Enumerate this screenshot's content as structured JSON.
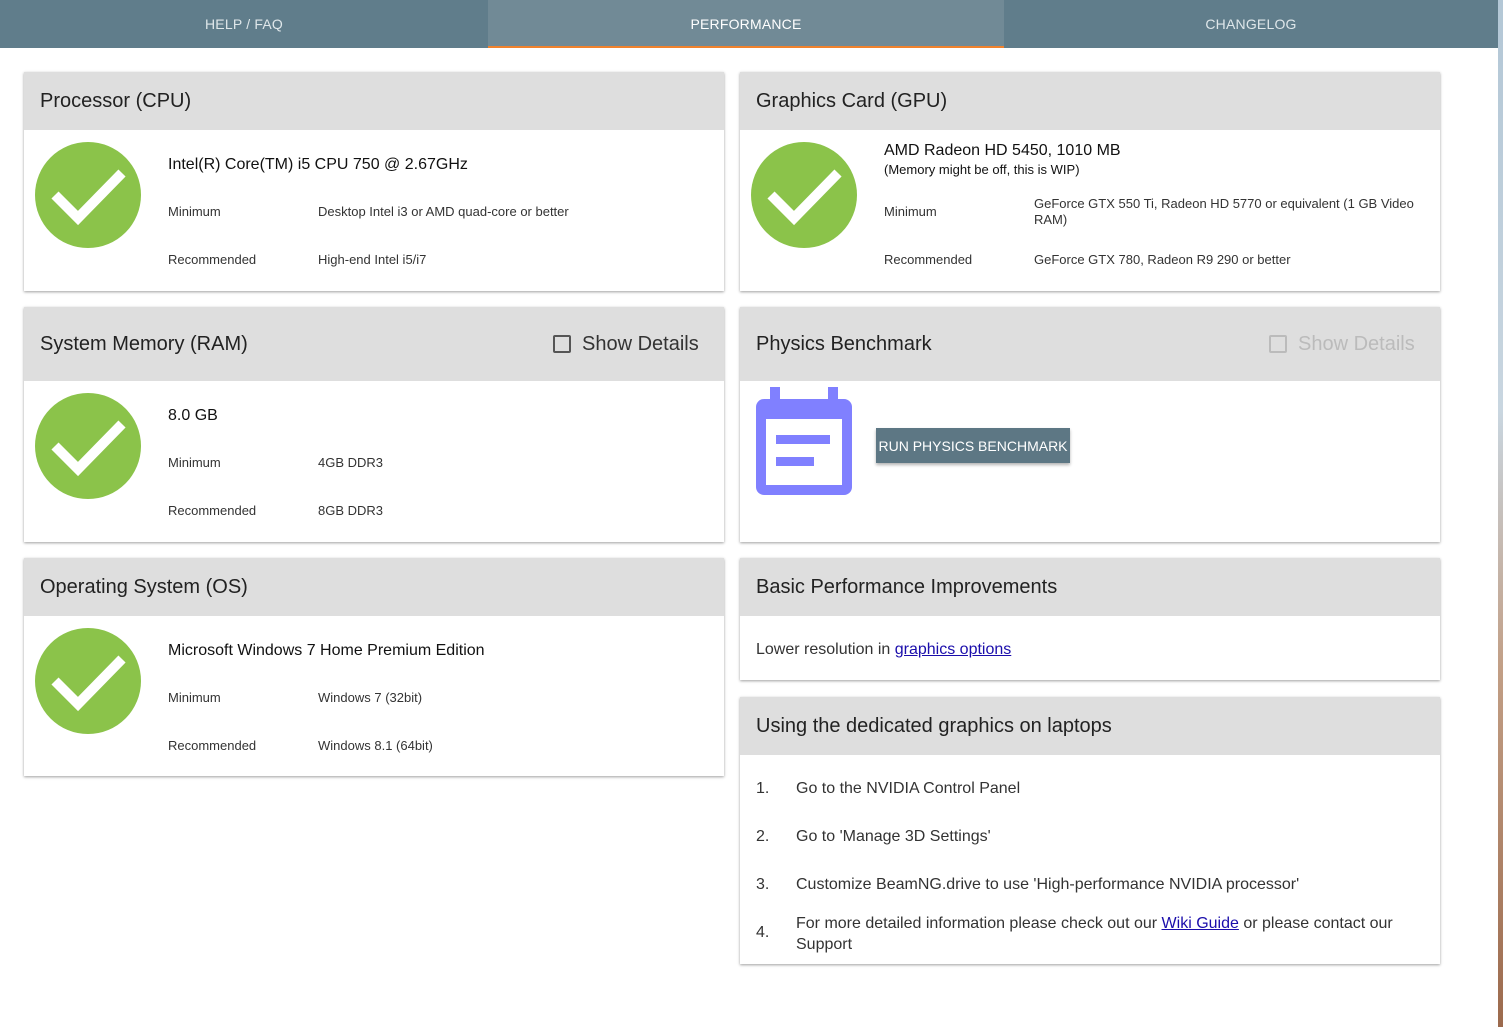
{
  "tabs": [
    {
      "label": "HELP / FAQ"
    },
    {
      "label": "PERFORMANCE"
    },
    {
      "label": "CHANGELOG"
    }
  ],
  "active_tab": "PERFORMANCE",
  "cpu": {
    "title": "Processor (CPU)",
    "value": "Intel(R) Core(TM) i5 CPU 750 @ 2.67GHz",
    "minimum_label": "Minimum",
    "minimum_value": "Desktop Intel i3 or AMD quad-core or better",
    "recommended_label": "Recommended",
    "recommended_value": "High-end Intel i5/i7",
    "status": "ok"
  },
  "gpu": {
    "title": "Graphics Card (GPU)",
    "value": "AMD Radeon HD 5450, 1010 MB",
    "note": "(Memory might be off, this is WIP)",
    "minimum_label": "Minimum",
    "minimum_value": "GeForce GTX 550 Ti, Radeon HD 5770 or equivalent (1 GB Video RAM)",
    "recommended_label": "Recommended",
    "recommended_value": "GeForce GTX 780, Radeon R9 290 or better",
    "status": "ok"
  },
  "ram": {
    "title": "System Memory (RAM)",
    "show_details": "Show Details",
    "value": "8.0 GB",
    "minimum_label": "Minimum",
    "minimum_value": "4GB DDR3",
    "recommended_label": "Recommended",
    "recommended_value": "8GB DDR3",
    "status": "ok"
  },
  "physics": {
    "title": "Physics Benchmark",
    "show_details": "Show Details",
    "button": "RUN PHYSICS BENCHMARK",
    "icon": "calendar-note-icon",
    "icon_color": "#8080ff"
  },
  "os": {
    "title": "Operating System (OS)",
    "value": "Microsoft Windows 7 Home Premium Edition",
    "minimum_label": "Minimum",
    "minimum_value": "Windows 7 (32bit)",
    "recommended_label": "Recommended",
    "recommended_value": "Windows 8.1 (64bit)",
    "status": "ok"
  },
  "improvements": {
    "title": "Basic Performance Improvements",
    "text": "Lower resolution in ",
    "link": "graphics options"
  },
  "laptops": {
    "title": "Using the dedicated graphics on laptops",
    "steps": [
      {
        "num": "1.",
        "text": "Go to the NVIDIA Control Panel"
      },
      {
        "num": "2.",
        "text": "Go to 'Manage 3D Settings'"
      },
      {
        "num": "3.",
        "text": "Customize BeamNG.drive to use 'High-performance NVIDIA processor'"
      },
      {
        "num": "4.",
        "text_before": "For more detailed information please check out our ",
        "link": "Wiki Guide",
        "text_after": " or please contact our Support"
      }
    ]
  },
  "colors": {
    "tabbar": "#607d8b",
    "tab_active": "#718a96",
    "tab_indicator": "#f0822d",
    "card_header": "#dedede",
    "check_green": "#8bc34a",
    "button": "#5d7784"
  }
}
